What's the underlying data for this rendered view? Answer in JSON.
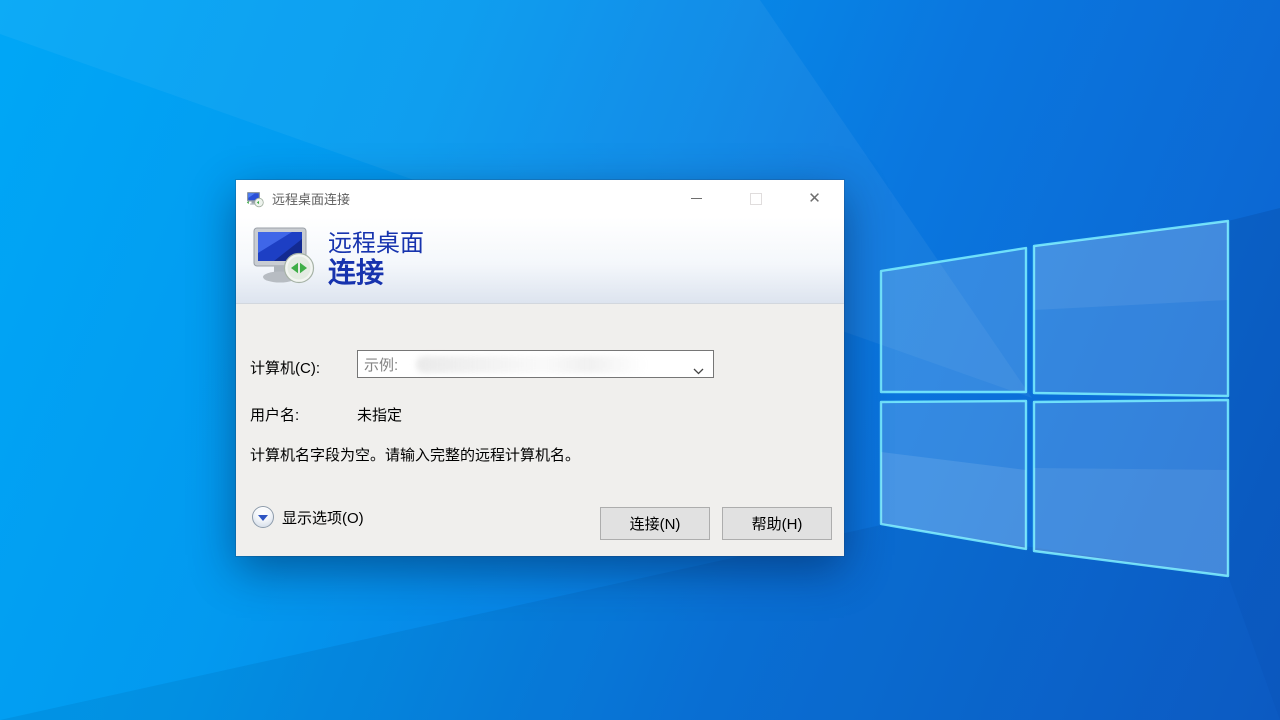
{
  "window": {
    "title": "远程桌面连接",
    "controls": {
      "minimize_glyph": "—",
      "close_glyph": "✕"
    }
  },
  "header": {
    "line1": "远程桌面",
    "line2": "连接"
  },
  "form": {
    "computer_label": "计算机(C):",
    "computer_value": "示例:",
    "username_label": "用户名:",
    "username_value": "未指定",
    "message": "计算机名字段为空。请输入完整的远程计算机名。"
  },
  "footer": {
    "options_label": "显示选项(O)",
    "connect_label": "连接(N)",
    "help_label": "帮助(H)"
  },
  "icons": {
    "titlebar_app_icon": "rdp-monitor",
    "header_icon": "rdp-monitor-large",
    "combo_chevron": "chevron-down",
    "options_expand": "triangle-down"
  },
  "colors": {
    "header_text_blue": "#1733ae",
    "desktop_top_left": "#00a7f6",
    "desktop_bottom_right": "#0d60cd",
    "logo_edge_cyan": "#7df1ff",
    "dialog_body": "#f0efed",
    "button_face": "#e1e1e1",
    "button_border": "#adadad"
  }
}
